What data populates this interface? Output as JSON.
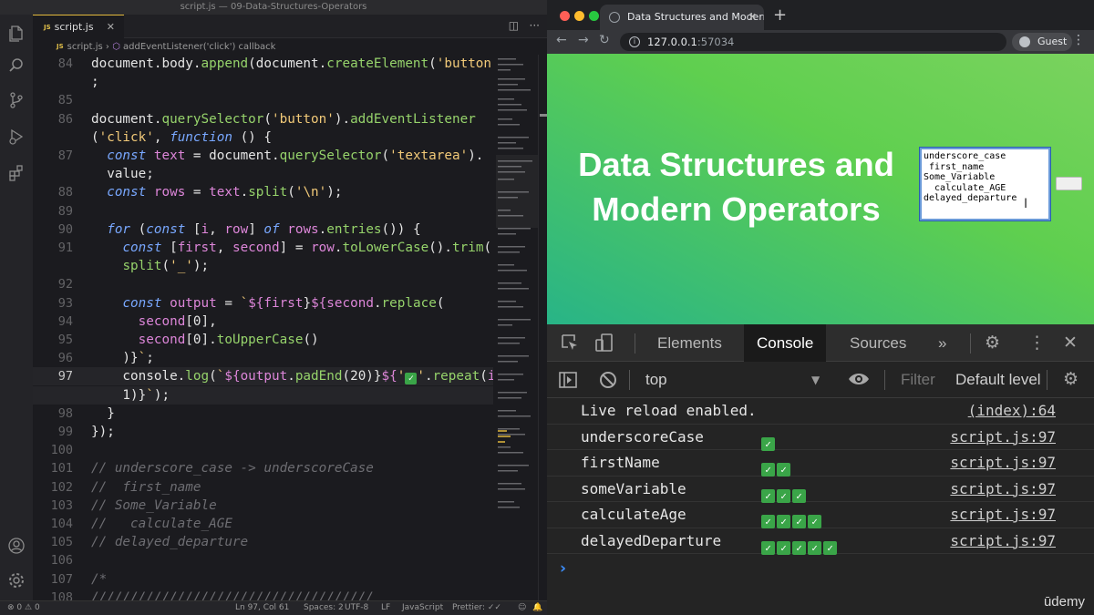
{
  "vscode": {
    "window_title": "script.js — 09-Data-Structures-Operators",
    "tab_label": "script.js",
    "tab_lang_badge": "JS",
    "breadcrumb": [
      "script.js",
      "addEventListener('click') callback"
    ],
    "code_lines": [
      {
        "n": "84",
        "t": "document.body.append(document.createElement('button'))"
      },
      {
        "n": "",
        "t": ";"
      },
      {
        "n": "85",
        "t": ""
      },
      {
        "n": "86",
        "t": "document.querySelector('button').addEventListener"
      },
      {
        "n": "",
        "t": "('click', function () {"
      },
      {
        "n": "87",
        "t": "  const text = document.querySelector('textarea')."
      },
      {
        "n": "",
        "t": "  value;"
      },
      {
        "n": "88",
        "t": "  const rows = text.split('\\n');"
      },
      {
        "n": "89",
        "t": ""
      },
      {
        "n": "90",
        "t": "  for (const [i, row] of rows.entries()) {"
      },
      {
        "n": "91",
        "t": "    const [first, second] = row.toLowerCase().trim()."
      },
      {
        "n": "",
        "t": "    split('_');"
      },
      {
        "n": "92",
        "t": ""
      },
      {
        "n": "93",
        "t": "    const output = `${first}${second.replace("
      },
      {
        "n": "94",
        "t": "      second[0],"
      },
      {
        "n": "95",
        "t": "      second[0].toUpperCase()"
      },
      {
        "n": "96",
        "t": "    )}`;"
      },
      {
        "n": "97",
        "t": "    console.log(`${output.padEnd(20)}${'✅'.repeat(i +"
      },
      {
        "n": "",
        "t": "    1)}`);"
      },
      {
        "n": "98",
        "t": "  }"
      },
      {
        "n": "99",
        "t": "});"
      },
      {
        "n": "100",
        "t": ""
      },
      {
        "n": "101",
        "t": "// underscore_case -> underscoreCase"
      },
      {
        "n": "102",
        "t": "//  first_name"
      },
      {
        "n": "103",
        "t": "// Some_Variable"
      },
      {
        "n": "104",
        "t": "//   calculate_AGE"
      },
      {
        "n": "105",
        "t": "// delayed_departure"
      },
      {
        "n": "106",
        "t": ""
      },
      {
        "n": "107",
        "t": "/*"
      },
      {
        "n": "108",
        "t": "////////////////////////////////////"
      }
    ],
    "status": {
      "errors": "0",
      "warnings": "0",
      "position": "Ln 97, Col 61",
      "spaces": "Spaces: 2",
      "encoding": "UTF-8",
      "eol": "LF",
      "language": "JavaScript",
      "prettier": "Prettier: ✓✓"
    }
  },
  "browser": {
    "tab_title": "Data Structures and Modern O",
    "url_host": "127.0.0.1",
    "url_port": ":57034",
    "profile": "Guest",
    "page": {
      "heading_line1": "Data Structures and",
      "heading_line2": "Modern Operators",
      "textarea_value": "underscore_case\n first_name\nSome_Variable\n  calculate_AGE\ndelayed_departure"
    },
    "devtools": {
      "tabs": [
        "Elements",
        "Console",
        "Sources"
      ],
      "active_tab": "Console",
      "context": "top",
      "filter_placeholder": "Filter",
      "levels": "Default levels",
      "logs": [
        {
          "message": "Live reload enabled.",
          "checks": 0,
          "source": "(index):64"
        },
        {
          "message": "underscoreCase",
          "checks": 1,
          "source": "script.js:97"
        },
        {
          "message": "firstName",
          "checks": 2,
          "source": "script.js:97"
        },
        {
          "message": "someVariable",
          "checks": 3,
          "source": "script.js:97"
        },
        {
          "message": "calculateAge",
          "checks": 4,
          "source": "script.js:97"
        },
        {
          "message": "delayedDeparture",
          "checks": 5,
          "source": "script.js:97"
        }
      ]
    },
    "watermark": "ūdemy"
  },
  "colors": {
    "accent_green": "#3aa548",
    "devtools_link": "#3c8dfb",
    "editor_bg": "#1b1b1f"
  }
}
